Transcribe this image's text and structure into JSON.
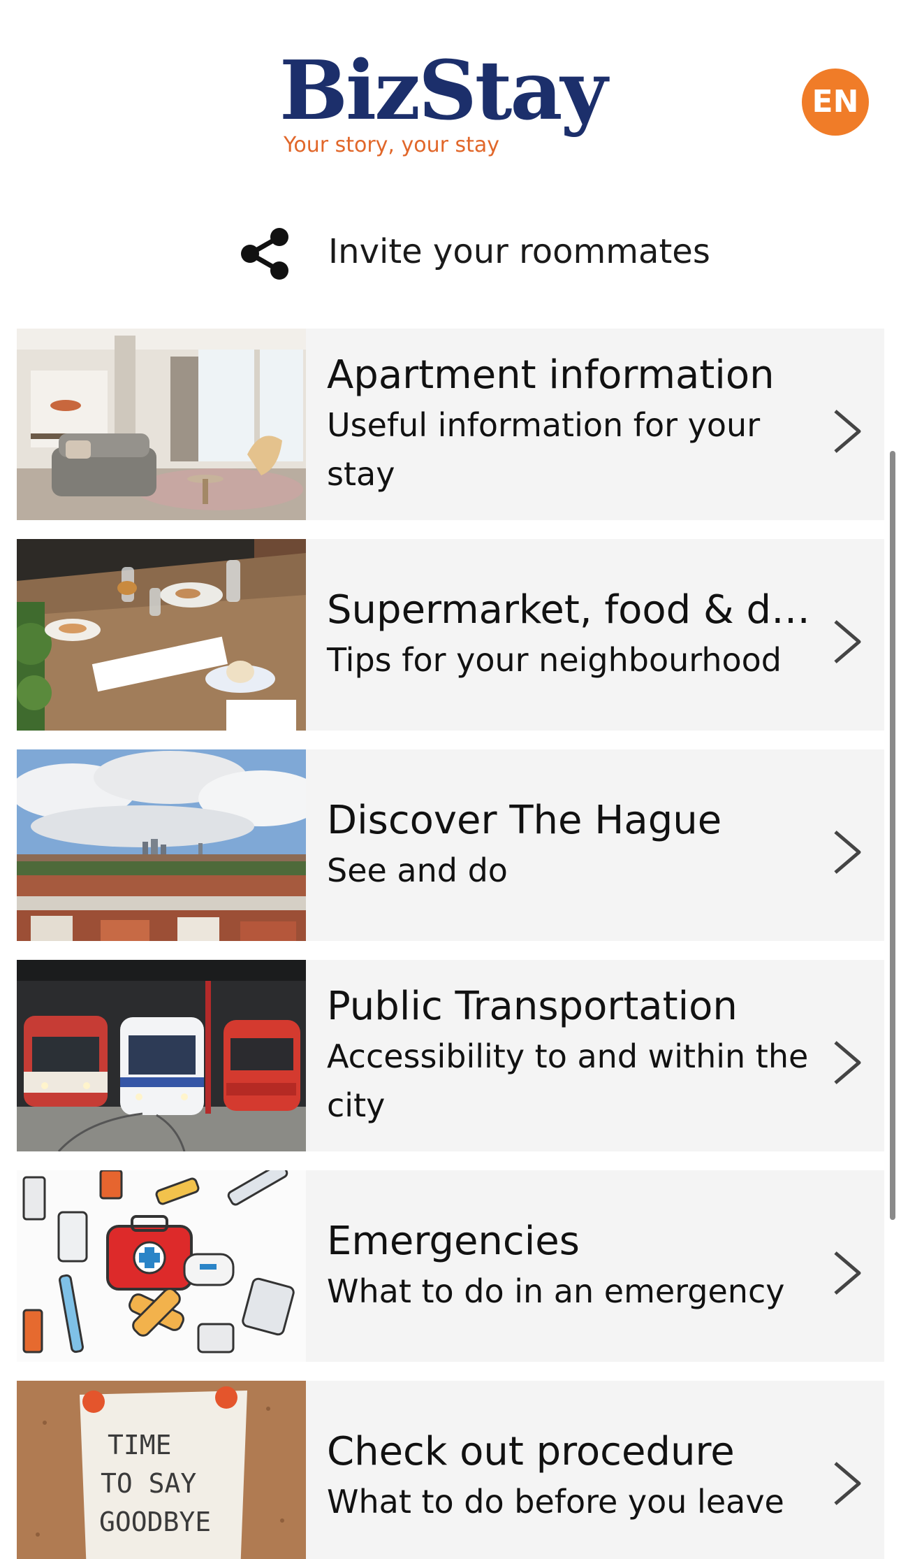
{
  "header": {
    "brand": "BizStay",
    "tagline": "Your story, your stay",
    "language": "EN",
    "colors": {
      "brand": "#1c2f6b",
      "tagline": "#e1672a",
      "language_bg": "#f07c28"
    }
  },
  "invite": {
    "icon": "share-icon",
    "label": "Invite your roommates"
  },
  "menu": {
    "items": [
      {
        "title": "Apartment information",
        "subtitle": "Useful information for your stay",
        "image": "living-room-photo"
      },
      {
        "title": "Supermarket, food & drinks",
        "subtitle": "Tips for your neighbourhood",
        "image": "dining-table-photo"
      },
      {
        "title": "Discover The Hague",
        "subtitle": "See and do",
        "image": "city-skyline-photo"
      },
      {
        "title": "Public Transportation",
        "subtitle": "Accessibility to and within the city",
        "image": "trams-photo"
      },
      {
        "title": "Emergencies",
        "subtitle": "What to do in an emergency",
        "image": "first-aid-illustration"
      },
      {
        "title": "Check out procedure",
        "subtitle": "What to do before you leave",
        "image": "goodbye-note-photo"
      }
    ],
    "note_text": [
      "TIME",
      "TO SAY",
      "GOODBYE"
    ]
  }
}
